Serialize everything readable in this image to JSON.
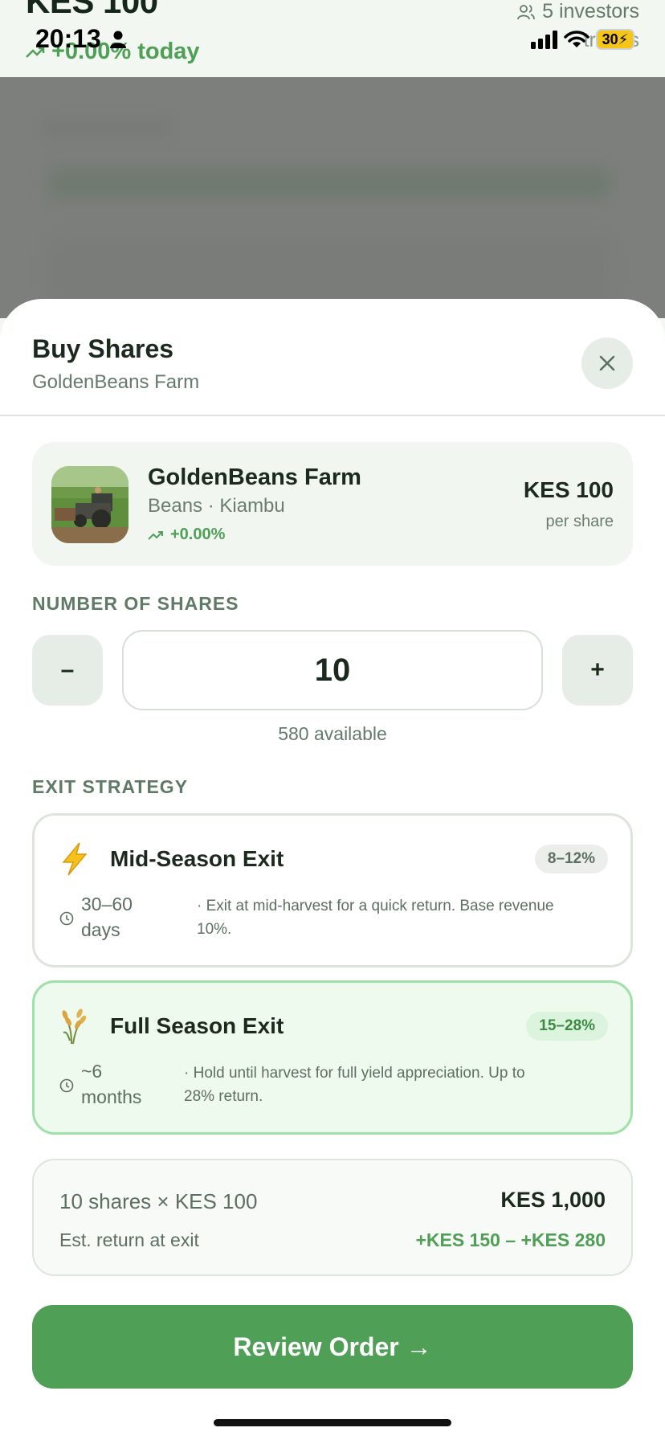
{
  "background": {
    "price": "KES 100",
    "change": "+0.00% today",
    "investors": "5 investors",
    "investors_sub": "trades"
  },
  "status_bar": {
    "time": "20:13",
    "battery": "30"
  },
  "sheet": {
    "title": "Buy Shares",
    "subtitle": "GoldenBeans Farm"
  },
  "farm": {
    "name": "GoldenBeans Farm",
    "meta": "Beans · Kiambu",
    "change": "+0.00%",
    "price": "KES 100",
    "price_unit": "per share"
  },
  "shares": {
    "label": "NUMBER OF SHARES",
    "minus": "–",
    "plus": "+",
    "quantity": "10",
    "available": "580 available"
  },
  "exit": {
    "label": "EXIT STRATEGY",
    "options": [
      {
        "title": "Mid-Season Exit",
        "badge": "8–12%",
        "duration_line1": "30–60",
        "duration_line2": "days",
        "desc_line1": "· Exit at mid-harvest for a quick return. Base revenue",
        "desc_line2": "10%.",
        "icon": "lightning-icon",
        "selected": false
      },
      {
        "title": "Full Season Exit",
        "badge": "15–28%",
        "duration_line1": "~6",
        "duration_line2": "months",
        "desc_line1": "· Hold until harvest for full yield appreciation. Up to",
        "desc_line2": "28% return.",
        "icon": "wheat-icon",
        "selected": true
      }
    ]
  },
  "summary": {
    "line": "10 shares × KES 100",
    "total": "KES 1,000",
    "est_label": "Est. return at exit",
    "est_value": "+KES 150 – +KES 280"
  },
  "cta": {
    "label": "Review Order →"
  },
  "colors": {
    "accent": "#4f9f57",
    "selected_border": "#9fe0a7",
    "text_primary": "#1c2a1e",
    "text_muted": "#667a6b"
  }
}
